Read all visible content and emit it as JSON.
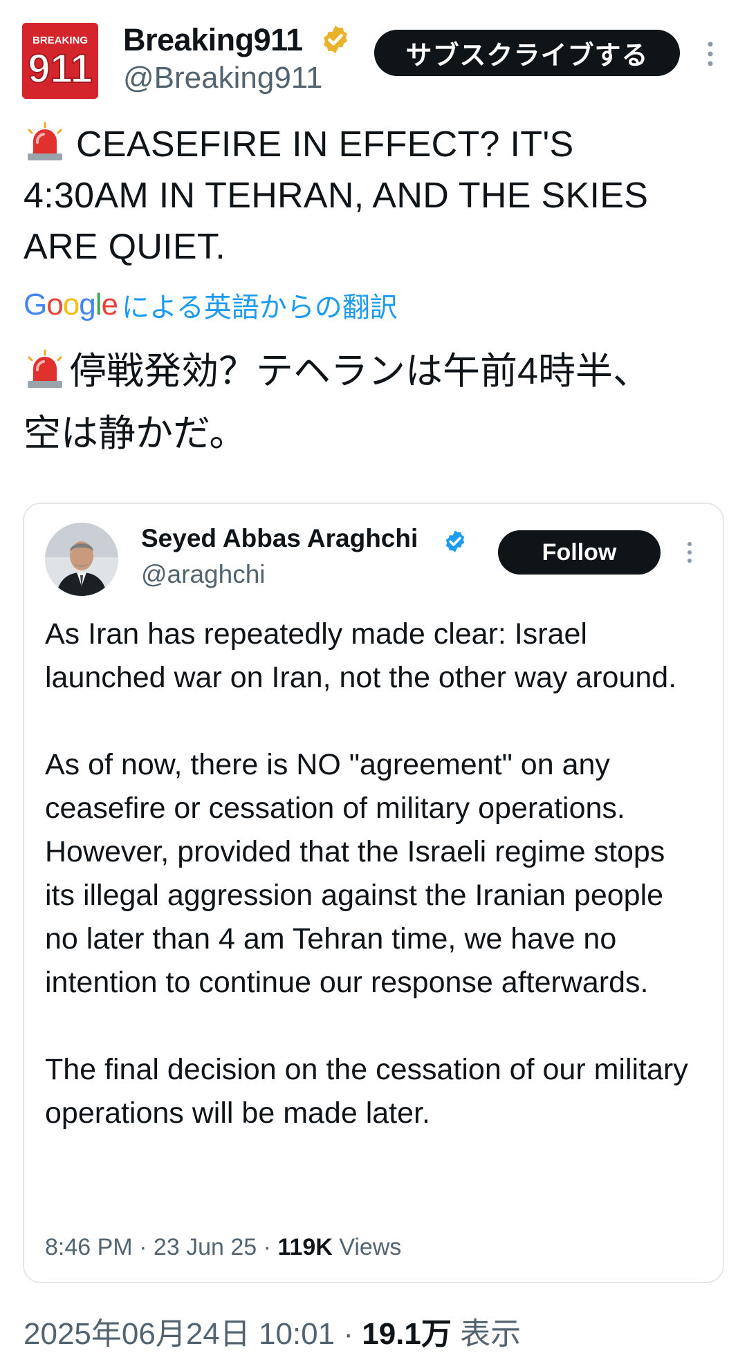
{
  "post": {
    "logo_text_top": "BREAKING",
    "logo_text_main": "911",
    "display_name": "Breaking911",
    "handle": "@Breaking911",
    "subscribe_label": "サブスクライブする",
    "text": "CEASEFIRE IN EFFECT? IT'S\n4:30AM IN TEHRAN, AND THE SKIES\nARE QUIET.",
    "translation": {
      "provider_logo": "Google",
      "label": "による英語からの翻訳",
      "text": "停戦発効？テヘランは午前4時半、\n空は静かだ。"
    },
    "timestamp": "2025年06月24日 10:01",
    "separator": "·",
    "views_count": "19.1万",
    "views_label": "表示"
  },
  "quoted": {
    "display_name": "Seyed Abbas Araghchi",
    "handle": "@araghchi",
    "follow_label": "Follow",
    "paragraphs": [
      "As Iran has repeatedly made clear: Israel launched war on Iran, not the other way around.",
      "As of now, there is NO \"agreement\" on any ceasefire or cessation of military operations. However, provided that the Israeli regime stops its illegal aggression against the Iranian people no later than 4 am Tehran time, we have no intention to continue our response afterwards.",
      "The final decision on the cessation of our military operations will be made later."
    ],
    "time": "8:46 PM",
    "date": "23 Jun 25",
    "separator": "·",
    "views_count": "119K",
    "views_label": "Views"
  },
  "icons": {
    "siren": "siren-emoji-icon",
    "verified_gold": "verified-gold-badge-icon",
    "verified_blue": "verified-blue-badge-icon",
    "more": "vertical-ellipsis-icon"
  },
  "colors": {
    "accent_link": "#1d9bf0",
    "brand_red": "#d3252b",
    "gold_badge": "#e8b32b",
    "blue_badge": "#1d9bf0",
    "button_dark": "#0f1419",
    "secondary_text": "#536471"
  }
}
